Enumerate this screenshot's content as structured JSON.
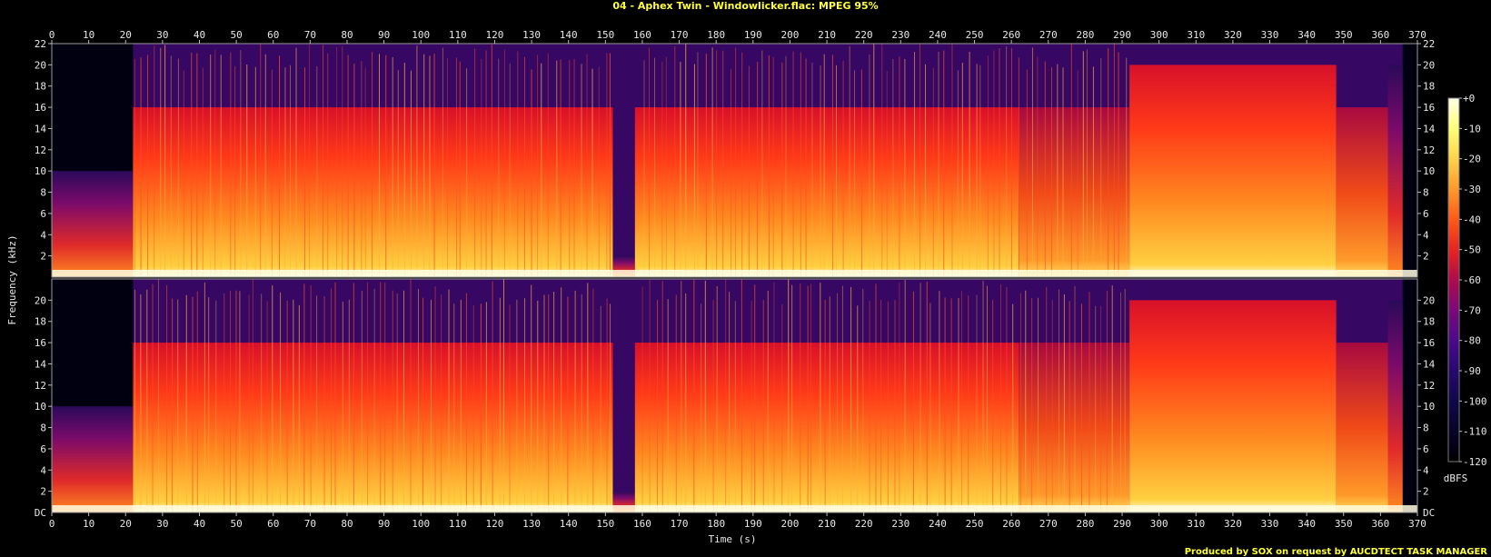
{
  "title": "04 - Aphex Twin - Windowlicker.flac: MPEG 95%",
  "footer": "Produced by SOX on request by AUCDTECT TASK MANAGER",
  "colorbar": {
    "unit": "dBFS",
    "ticks": [
      "+0",
      "-10",
      "-20",
      "-30",
      "-40",
      "-50",
      "-60",
      "-70",
      "-80",
      "-90",
      "-100",
      "-110",
      "-120"
    ],
    "colors": [
      "#ffffe8",
      "#ffff7a",
      "#ffd24a",
      "#ff9a2a",
      "#ff5a18",
      "#e82420",
      "#b00a4a",
      "#7a0a7a",
      "#4a0a8a",
      "#260a6e",
      "#10084a",
      "#080428",
      "#000000"
    ]
  },
  "chart_data": {
    "type": "heatmap",
    "title": "04 - Aphex Twin - Windowlicker.flac: MPEG 95%",
    "xlabel": "Time (s)",
    "ylabel": "Frequency (kHz)",
    "x_ticks": [
      "0",
      "10",
      "20",
      "30",
      "40",
      "50",
      "60",
      "70",
      "80",
      "90",
      "100",
      "110",
      "120",
      "130",
      "140",
      "150",
      "160",
      "170",
      "180",
      "190",
      "200",
      "210",
      "220",
      "230",
      "240",
      "250",
      "260",
      "270",
      "280",
      "290",
      "300",
      "310",
      "320",
      "330",
      "340",
      "350",
      "360",
      "370"
    ],
    "y_ticks": [
      "22",
      "20",
      "18",
      "16",
      "14",
      "12",
      "10",
      "8",
      "6",
      "4",
      "2"
    ],
    "y_ticks_bottom_dc": "DC",
    "xlim": [
      0,
      370
    ],
    "ylim_khz": [
      0,
      22
    ],
    "channels": 2,
    "colorbar_range_dbfs": [
      -120,
      0
    ],
    "sections": [
      {
        "start": 0,
        "end": 22,
        "cutoff_khz": 10,
        "level": "low"
      },
      {
        "start": 22,
        "end": 152,
        "cutoff_khz": 16,
        "level": "high"
      },
      {
        "start": 152,
        "end": 158,
        "cutoff_khz": 2,
        "level": "low"
      },
      {
        "start": 158,
        "end": 262,
        "cutoff_khz": 16,
        "level": "high"
      },
      {
        "start": 262,
        "end": 292,
        "cutoff_khz": 16,
        "level": "medium"
      },
      {
        "start": 292,
        "end": 348,
        "cutoff_khz": 20,
        "level": "high"
      },
      {
        "start": 348,
        "end": 362,
        "cutoff_khz": 16,
        "level": "medium"
      },
      {
        "start": 362,
        "end": 366,
        "cutoff_khz": 20,
        "level": "low"
      }
    ]
  }
}
